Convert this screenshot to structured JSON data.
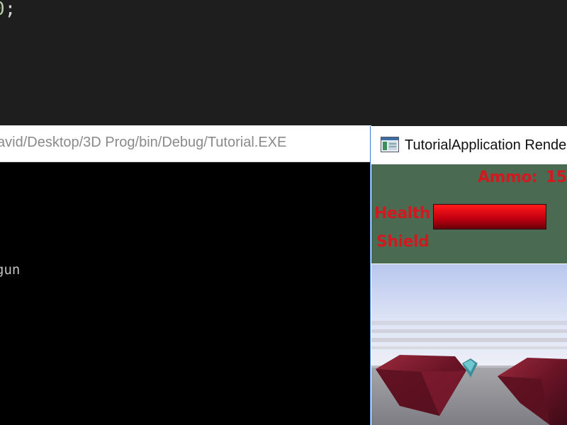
{
  "editor": {
    "code_number": "0",
    "code_rest": ";"
  },
  "console": {
    "title": "avid/Desktop/3D Prog/bin/Debug/Tutorial.EXE",
    "output_line": "gun"
  },
  "render_window": {
    "title": "TutorialApplication Rende",
    "icon": "app-window-icon"
  },
  "hud": {
    "ammo_label": "Ammo:",
    "ammo_value": "15",
    "health_label": "Health",
    "shield_label": "Shield",
    "health_level": 1.0,
    "colors": {
      "hud_background": "#4a6b52",
      "hud_text": "#d01a20",
      "health_bar": "#c40010"
    }
  },
  "scene": {
    "objects": [
      "red-crystal",
      "red-crystal",
      "blue-crystal"
    ]
  }
}
